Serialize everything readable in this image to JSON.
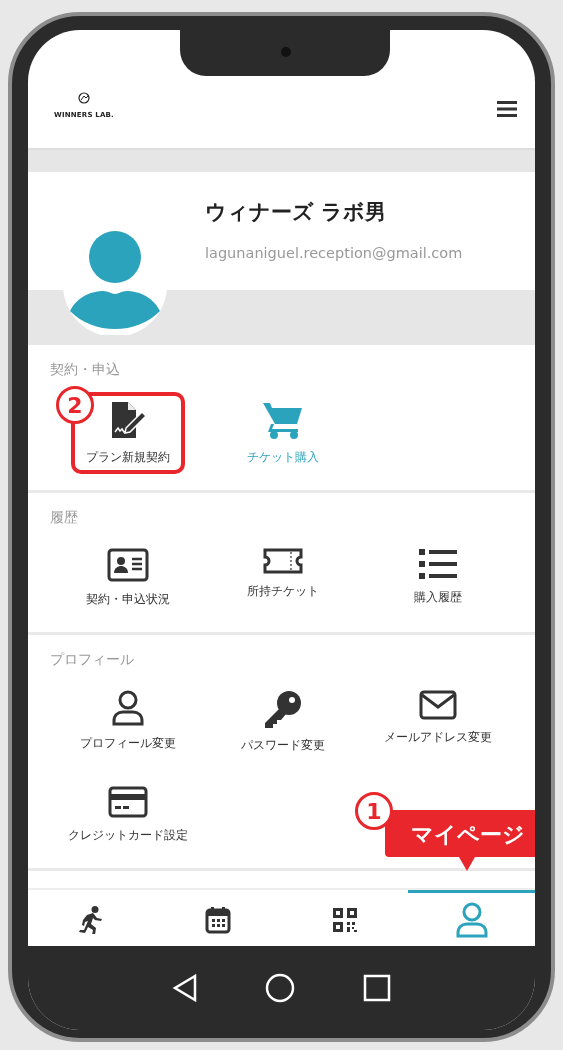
{
  "header": {
    "logo_text": "WINNERS LAB."
  },
  "profile": {
    "name": "ウィナーズ ラボ男",
    "email": "lagunaniguel.reception@gmail.com"
  },
  "sections": [
    {
      "title": "契約・申込",
      "items": [
        {
          "label": "プラン新規契約",
          "kind": "contract",
          "accent": false,
          "callout": "2"
        },
        {
          "label": "チケット購入",
          "kind": "cart",
          "accent": true
        }
      ]
    },
    {
      "title": "履歴",
      "items": [
        {
          "label": "契約・申込状況",
          "kind": "idcard",
          "accent": false
        },
        {
          "label": "所持チケット",
          "kind": "ticket",
          "accent": false
        },
        {
          "label": "購入履歴",
          "kind": "list",
          "accent": false
        }
      ]
    },
    {
      "title": "プロフィール",
      "items": [
        {
          "label": "プロフィール変更",
          "kind": "user",
          "accent": false
        },
        {
          "label": "パスワード変更",
          "kind": "key",
          "accent": false
        },
        {
          "label": "メールアドレス変更",
          "kind": "mail",
          "accent": false
        },
        {
          "label": "クレジットカード設定",
          "kind": "card",
          "accent": false
        }
      ]
    }
  ],
  "bottom_nav": [
    {
      "kind": "run",
      "selected": false
    },
    {
      "kind": "calendar",
      "selected": false
    },
    {
      "kind": "qr",
      "selected": false
    },
    {
      "kind": "user",
      "selected": true,
      "callout": {
        "number": "1",
        "text": "マイページ"
      }
    }
  ]
}
